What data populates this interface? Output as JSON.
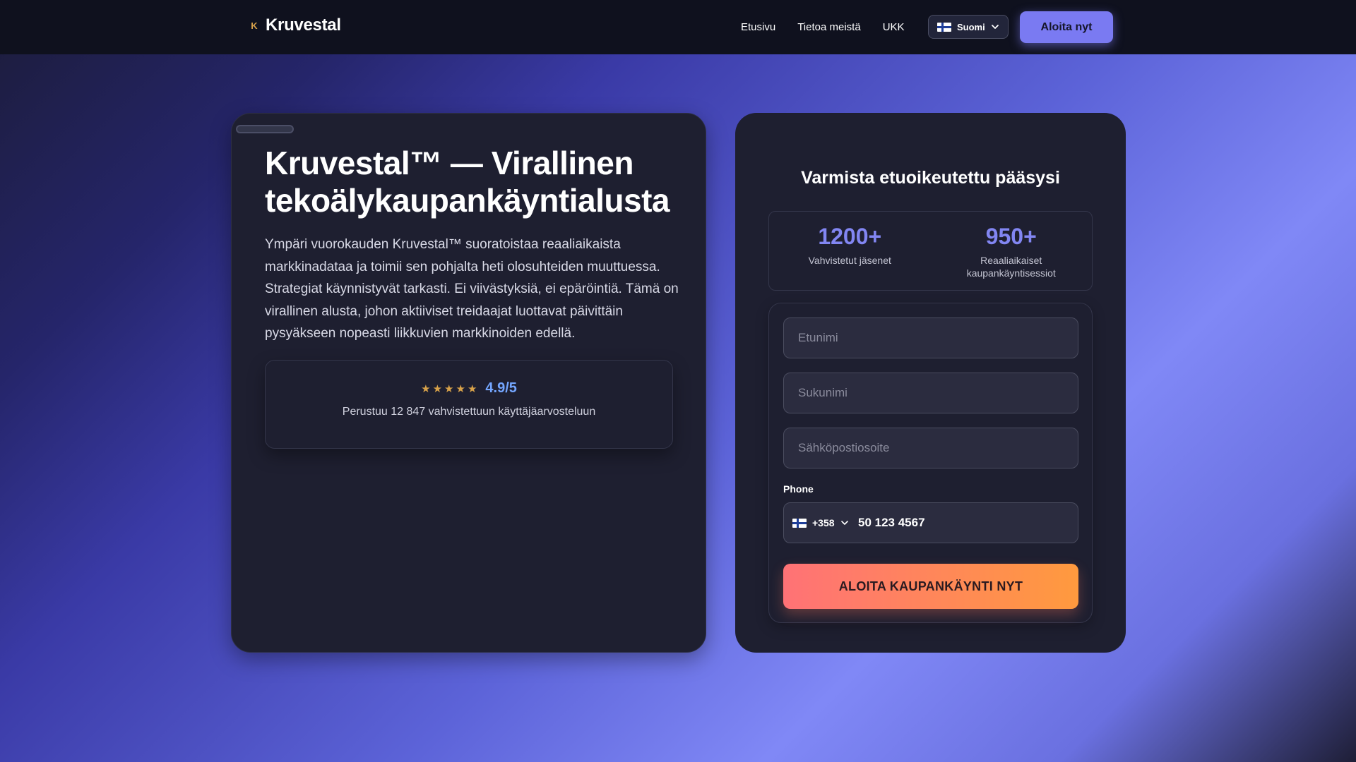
{
  "header": {
    "brand_mark": "K",
    "brand_name": "Kruvestal",
    "nav": [
      {
        "label": "Etusivu"
      },
      {
        "label": "Tietoa meistä"
      },
      {
        "label": "UKK"
      }
    ],
    "language": {
      "label": "Suomi",
      "flag_icon": "finland-flag-icon"
    },
    "cta_label": "Aloita nyt"
  },
  "hero": {
    "title": "Kruvestal™ — Virallinen tekoälykaupankäyntialusta",
    "description": "Ympäri vuorokauden Kruvestal™ suoratoistaa reaaliaikaista markkinadataa ja toimii sen pohjalta heti olosuhteiden muuttuessa. Strategiat käynnistyvät tarkasti. Ei viivästyksiä, ei epäröintiä. Tämä on virallinen alusta, johon aktiiviset treidaajat luottavat päivittäin pysyäkseen nopeasti liikkuvien markkinoiden edellä.",
    "rating": {
      "stars": 5,
      "score": "4.9/5",
      "subtitle": "Perustuu 12 847 vahvistettuun käyttäjäarvosteluun"
    }
  },
  "form": {
    "title": "Varmista etuoikeutettu pääsysi",
    "stats": [
      {
        "value": "1200+",
        "label": "Vahvistetut jäsenet"
      },
      {
        "value": "950+",
        "label": "Reaaliaikaiset kaupankäyntisessiot"
      }
    ],
    "first_name_placeholder": "Etunimi",
    "last_name_placeholder": "Sukunimi",
    "email_placeholder": "Sähköpostiosoite",
    "phone_label": "Phone",
    "country_code": "+358",
    "phone_value": "50 123 4567",
    "submit_label": "ALOITA KAUPANKÄYNTI NYT"
  },
  "colors": {
    "accent": "#7a7af2",
    "stat_value": "#8286f2",
    "score": "#74a6ff",
    "star": "#d8a24a",
    "submit_start": "#ff7276",
    "submit_end": "#ff9a3e"
  }
}
